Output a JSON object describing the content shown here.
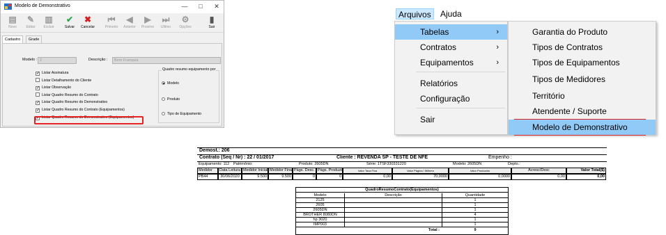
{
  "dialog": {
    "title": "Modelo de Demonstrativo",
    "window_buttons": {
      "minimize": "—",
      "maximize": "□",
      "close": "✕"
    },
    "toolbar": [
      {
        "label": "Novo",
        "icon": "new-doc-icon",
        "glyph": "▤",
        "enabled": false
      },
      {
        "label": "Editar",
        "icon": "edit-icon",
        "glyph": "✎",
        "enabled": false
      },
      {
        "label": "Excluir",
        "icon": "delete-icon",
        "glyph": "▥",
        "enabled": false
      },
      {
        "label": "Salvar",
        "icon": "check-icon",
        "glyph": "✔",
        "enabled": true,
        "color": "#2fa84f"
      },
      {
        "label": "Cancelar",
        "icon": "x-icon",
        "glyph": "✖",
        "enabled": true,
        "color": "#d42020"
      },
      {
        "label": "Primeiro",
        "icon": "first-icon",
        "glyph": "⏮",
        "enabled": false
      },
      {
        "label": "Anterior",
        "icon": "prev-icon",
        "glyph": "◀",
        "enabled": false
      },
      {
        "label": "Proximo",
        "icon": "next-icon",
        "glyph": "▶",
        "enabled": false
      },
      {
        "label": "Ultimo",
        "icon": "last-icon",
        "glyph": "⏭",
        "enabled": false
      },
      {
        "label": "Opções",
        "icon": "options-icon",
        "glyph": "⚙",
        "enabled": false
      },
      {
        "label": "Sair",
        "icon": "exit-icon",
        "glyph": "▮",
        "enabled": true
      }
    ],
    "tabs": [
      "Cadastro",
      "Grade"
    ],
    "modelo_label": "Modelo :",
    "modelo_value": "2",
    "descricao_label": "Descrição :",
    "descricao_value": "Bem Franquia",
    "checkboxes": [
      {
        "label": "Listar Assinatura",
        "checked": true
      },
      {
        "label": "Listar Detalhamento do Cliente",
        "checked": false
      },
      {
        "label": "Listar Observação",
        "checked": true
      },
      {
        "label": "Listar Quadro Resumo do Contrato",
        "checked": false
      },
      {
        "label": "Listar Quadro Resumo do Demonstrativo",
        "checked": true
      },
      {
        "label": "Listar Quadro Resumo do Contrato (Equipamentos)",
        "checked": true
      },
      {
        "label": "Listar Quadro Resumo do Demonstrativo (Equipamentos)",
        "checked": true
      }
    ],
    "group_title": "Quadro resumo equipamento por",
    "radios": [
      {
        "label": "Modelo",
        "selected": true
      },
      {
        "label": "Produto",
        "selected": false
      },
      {
        "label": "Tipo de Equipamento",
        "selected": false
      }
    ]
  },
  "menu": {
    "bar": [
      "Arquivos",
      "Ajuda"
    ],
    "items": [
      {
        "label": "Tabelas",
        "has_sub": true,
        "hover": true
      },
      {
        "label": "Contratos",
        "has_sub": true
      },
      {
        "label": "Equipamentos",
        "has_sub": true
      },
      {
        "label": "Relatórios",
        "has_sub": false
      },
      {
        "label": "Configuração",
        "has_sub": false
      },
      {
        "label": "Sair",
        "has_sub": false
      }
    ],
    "arrow": "›",
    "submenu": [
      "Garantia do Produto",
      "Tipos de Contratos",
      "Tipos de Equipamentos",
      "Tipos de Medidores",
      "Território",
      "Atendente / Suporte",
      "Modelo de Demonstrativo"
    ],
    "selected_submenu": "Modelo de Demonstrativo",
    "highlight_color": "#e52222"
  },
  "report": {
    "demost": "Demost.: 206",
    "contrato": "Contrato (Seq / Nr) : 22 / 01/2017",
    "cliente": "Cliente : REVENDA  SP  -  TESTE DE NFE",
    "empenho": "Empenho :",
    "equipamento": "Equipamento: 112",
    "patrimonio": "Patrimônio:",
    "produto": "Produto: 2605DN",
    "serie": "Série: 1TSF330331220",
    "modelo": "Modelo: 2605DN",
    "depto": "Depto.:",
    "headers": [
      "Medidor",
      "Data Leitura",
      "Medidor Inicial",
      "Medidor Final",
      "Pàgs. Desc.",
      "Pàgs. Produzidas",
      "Valor Taxa Fixa",
      "Valor Página / Milhero",
      "Valor Produzido",
      "Acresc/Desc",
      "Valor Total($)"
    ],
    "row": [
      "PB44",
      "30/06/2020",
      "9.500",
      "9.500",
      "0",
      "0",
      "0,00",
      "70,0000",
      "0,0000",
      "0,00",
      "0,00"
    ],
    "quadro_title": "QuadroResumoContrato(Equipamentos)",
    "quadro_headers": [
      "Modelo",
      "Descrição",
      "Quantidade"
    ],
    "quadro_rows": [
      [
        "2125",
        "",
        "1"
      ],
      [
        "2605",
        "",
        "1"
      ],
      [
        "2605DN",
        "",
        "1"
      ],
      [
        "BROTHER  8080DN",
        "",
        "4"
      ],
      [
        "hp 3020",
        "",
        "1"
      ],
      [
        "IMP003",
        "",
        "1"
      ]
    ],
    "total_label": "Total :",
    "total_value": "9"
  }
}
